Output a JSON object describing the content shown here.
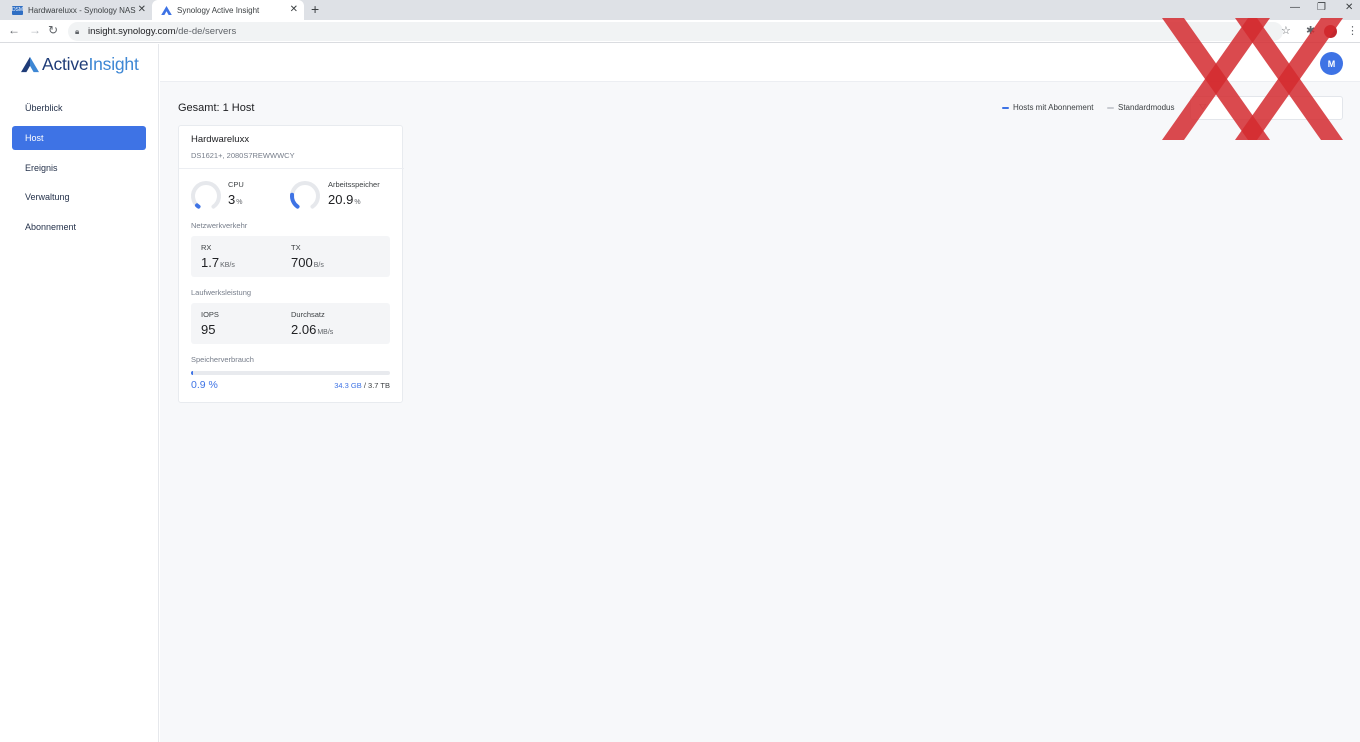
{
  "browser": {
    "tabs": [
      {
        "title": "Hardwareluxx - Synology NAS",
        "favicon": "DSM",
        "active": false
      },
      {
        "title": "Synology Active Insight",
        "active": true
      }
    ],
    "url_host": "insight.synology.com",
    "url_path": "/de-de/servers"
  },
  "app": {
    "logo_part1": "Active",
    "logo_part2": "Insight",
    "avatar_initial": "M",
    "accent_color": "#3e73e5"
  },
  "sidebar": {
    "items": [
      {
        "label": "Überblick",
        "active": false
      },
      {
        "label": "Host",
        "active": true
      },
      {
        "label": "Ereignis",
        "active": false
      },
      {
        "label": "Verwaltung",
        "active": false
      },
      {
        "label": "Abonnement",
        "active": false
      }
    ]
  },
  "header": {
    "total": "Gesamt: 1 Host",
    "legend": [
      {
        "label": "Hosts mit Abonnement",
        "color": "#3e73e5"
      },
      {
        "label": "Standardmodus",
        "color": "#c9ccd2"
      }
    ],
    "filter_placeholder": ""
  },
  "host": {
    "name": "Hardwareluxx",
    "model": "DS1621+, 2080S7REWWWCY",
    "cpu": {
      "label": "CPU",
      "value": "3",
      "unit": "%",
      "fraction": 0.03
    },
    "memory": {
      "label": "Arbeitsspeicher",
      "value": "20.9",
      "unit": "%",
      "fraction": 0.209
    },
    "network_label": "Netzwerkverkehr",
    "rx": {
      "label": "RX",
      "value": "1.7",
      "unit": "KB/s"
    },
    "tx": {
      "label": "TX",
      "value": "700",
      "unit": "B/s"
    },
    "drive_label": "Laufwerksleistung",
    "iops": {
      "label": "IOPS",
      "value": "95"
    },
    "throughput": {
      "label": "Durchsatz",
      "value": "2.06",
      "unit": "MB/s"
    },
    "storage_label": "Speicherverbrauch",
    "storage_percent": "0.9 %",
    "storage_fraction": 0.009,
    "storage_used": "34.3 GB",
    "storage_sep": " / ",
    "storage_total": "3.7 TB"
  }
}
